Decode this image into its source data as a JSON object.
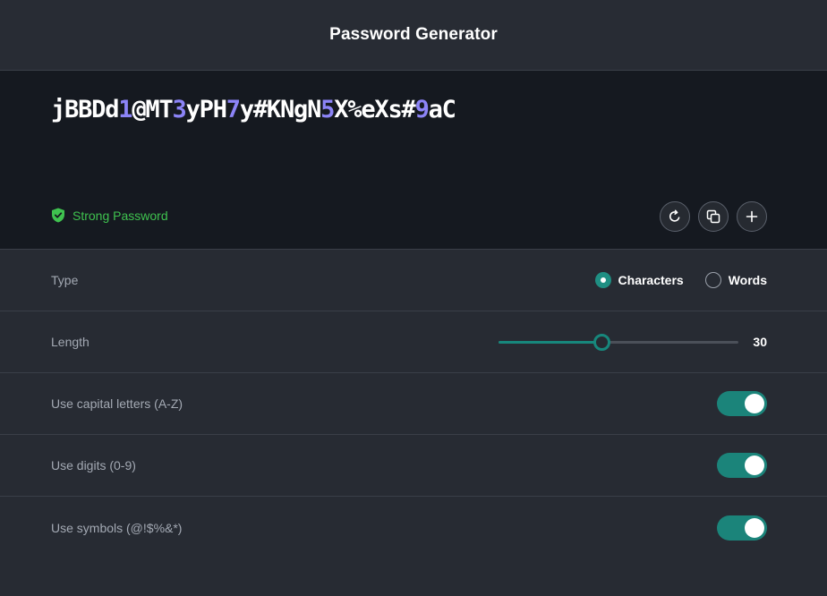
{
  "header": {
    "title": "Password Generator"
  },
  "password": {
    "segments": [
      {
        "text": "jBBDd",
        "type": "char"
      },
      {
        "text": "1",
        "type": "num"
      },
      {
        "text": "@MT",
        "type": "char"
      },
      {
        "text": "3",
        "type": "num"
      },
      {
        "text": "yPH",
        "type": "char"
      },
      {
        "text": "7",
        "type": "num"
      },
      {
        "text": "y#KNgN",
        "type": "char"
      },
      {
        "text": "5",
        "type": "num"
      },
      {
        "text": "X%eXs#",
        "type": "char"
      },
      {
        "text": "9",
        "type": "num"
      },
      {
        "text": "aC",
        "type": "char"
      }
    ],
    "strength_label": "Strong Password",
    "strength_icon": "shield-check-icon",
    "strength_color": "#3fc24f",
    "digit_color": "#8c84f7"
  },
  "actions": [
    {
      "name": "regenerate-button",
      "icon": "refresh-icon"
    },
    {
      "name": "copy-button",
      "icon": "copy-icon"
    },
    {
      "name": "add-button",
      "icon": "plus-icon"
    }
  ],
  "settings": {
    "type": {
      "label": "Type",
      "options": [
        {
          "label": "Characters",
          "selected": true
        },
        {
          "label": "Words",
          "selected": false
        }
      ]
    },
    "length": {
      "label": "Length",
      "value": "30",
      "fraction": 0.43
    },
    "capitals": {
      "label": "Use capital letters (A-Z)",
      "enabled": true
    },
    "digits": {
      "label": "Use digits (0-9)",
      "enabled": true
    },
    "symbols": {
      "label": "Use symbols (@!$%&*)",
      "enabled": true
    }
  },
  "colors": {
    "accent": "#1b847a",
    "background": "#272b33",
    "password_panel": "#151920"
  }
}
